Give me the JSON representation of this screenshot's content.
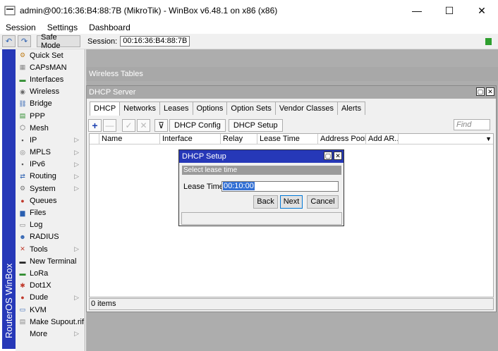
{
  "window": {
    "title": "admin@00:16:36:B4:88:7B (MikroTik) - WinBox v6.48.1 on x86 (x86)",
    "minimize": "—",
    "maximize": "☐",
    "close": "✕"
  },
  "menu": {
    "items": [
      "Session",
      "Settings",
      "Dashboard"
    ]
  },
  "toolbar": {
    "undo": "↶",
    "redo": "↷",
    "safe_mode": "Safe Mode",
    "session_label": "Session:",
    "session_value": "00:16:36:B4:88:7B",
    "status_color": "#2e9f2e"
  },
  "brand": {
    "text": "RouterOS WinBox"
  },
  "sidebar": {
    "items": [
      {
        "label": "Quick Set",
        "icon": "quickset-icon",
        "glyph": "⚙",
        "color": "#c08020",
        "arrow": false
      },
      {
        "label": "CAPsMAN",
        "icon": "capsman-icon",
        "glyph": "▦",
        "color": "#888",
        "arrow": false
      },
      {
        "label": "Interfaces",
        "icon": "interfaces-icon",
        "glyph": "▬",
        "color": "#2a8a2a",
        "arrow": false
      },
      {
        "label": "Wireless",
        "icon": "wireless-icon",
        "glyph": "◉",
        "color": "#6a6a6a",
        "arrow": false
      },
      {
        "label": "Bridge",
        "icon": "bridge-icon",
        "glyph": "⛓",
        "color": "#2a5fb0",
        "arrow": false
      },
      {
        "label": "PPP",
        "icon": "ppp-icon",
        "glyph": "▤",
        "color": "#2a8a2a",
        "arrow": false
      },
      {
        "label": "Mesh",
        "icon": "mesh-icon",
        "glyph": "⬡",
        "color": "#555",
        "arrow": false
      },
      {
        "label": "IP",
        "icon": "ip-icon",
        "glyph": "▪",
        "color": "#555",
        "arrow": true
      },
      {
        "label": "MPLS",
        "icon": "mpls-icon",
        "glyph": "◎",
        "color": "#777",
        "arrow": true
      },
      {
        "label": "IPv6",
        "icon": "ipv6-icon",
        "glyph": "▪",
        "color": "#555",
        "arrow": true
      },
      {
        "label": "Routing",
        "icon": "routing-icon",
        "glyph": "⇄",
        "color": "#2a5fb0",
        "arrow": true
      },
      {
        "label": "System",
        "icon": "system-icon",
        "glyph": "⚙",
        "color": "#777",
        "arrow": true
      },
      {
        "label": "Queues",
        "icon": "queues-icon",
        "glyph": "●",
        "color": "#c0392b",
        "arrow": false
      },
      {
        "label": "Files",
        "icon": "files-icon",
        "glyph": "▆",
        "color": "#2a5fb0",
        "arrow": false
      },
      {
        "label": "Log",
        "icon": "log-icon",
        "glyph": "▭",
        "color": "#777",
        "arrow": false
      },
      {
        "label": "RADIUS",
        "icon": "radius-icon",
        "glyph": "☻",
        "color": "#2a5fb0",
        "arrow": false
      },
      {
        "label": "Tools",
        "icon": "tools-icon",
        "glyph": "✕",
        "color": "#c0392b",
        "arrow": true
      },
      {
        "label": "New Terminal",
        "icon": "terminal-icon",
        "glyph": "▬",
        "color": "#222",
        "arrow": false
      },
      {
        "label": "LoRa",
        "icon": "lora-icon",
        "glyph": "▬",
        "color": "#2a8a2a",
        "arrow": false
      },
      {
        "label": "Dot1X",
        "icon": "dot1x-icon",
        "glyph": "✱",
        "color": "#c0392b",
        "arrow": false
      },
      {
        "label": "Dude",
        "icon": "dude-icon",
        "glyph": "●",
        "color": "#c0392b",
        "arrow": true
      },
      {
        "label": "KVM",
        "icon": "kvm-icon",
        "glyph": "▭",
        "color": "#2a5fb0",
        "arrow": false
      },
      {
        "label": "Make Supout.rif",
        "icon": "supout-icon",
        "glyph": "▤",
        "color": "#888",
        "arrow": false
      },
      {
        "label": "More",
        "icon": "",
        "glyph": "",
        "color": "#888",
        "arrow": true
      }
    ]
  },
  "wireless_tables": {
    "title": "Wireless Tables"
  },
  "dhcp_server": {
    "title": "DHCP Server",
    "tabs": [
      "DHCP",
      "Networks",
      "Leases",
      "Options",
      "Option Sets",
      "Vendor Classes",
      "Alerts"
    ],
    "active_tab": "DHCP",
    "buttons": {
      "add": "+",
      "remove": "—",
      "enable": "✓",
      "disable": "✕",
      "filter": "⊽",
      "config": "DHCP Config",
      "setup": "DHCP Setup"
    },
    "find_placeholder": "Find",
    "columns": [
      "Name",
      "Interface",
      "Relay",
      "Lease Time",
      "Address Pool",
      "Add AR..."
    ],
    "status": "0 items"
  },
  "dhcp_setup": {
    "title": "DHCP Setup",
    "message": "Select lease time",
    "lease_label": "Lease Time:",
    "lease_value": "00:10:00",
    "back": "Back",
    "next": "Next",
    "cancel": "Cancel"
  }
}
